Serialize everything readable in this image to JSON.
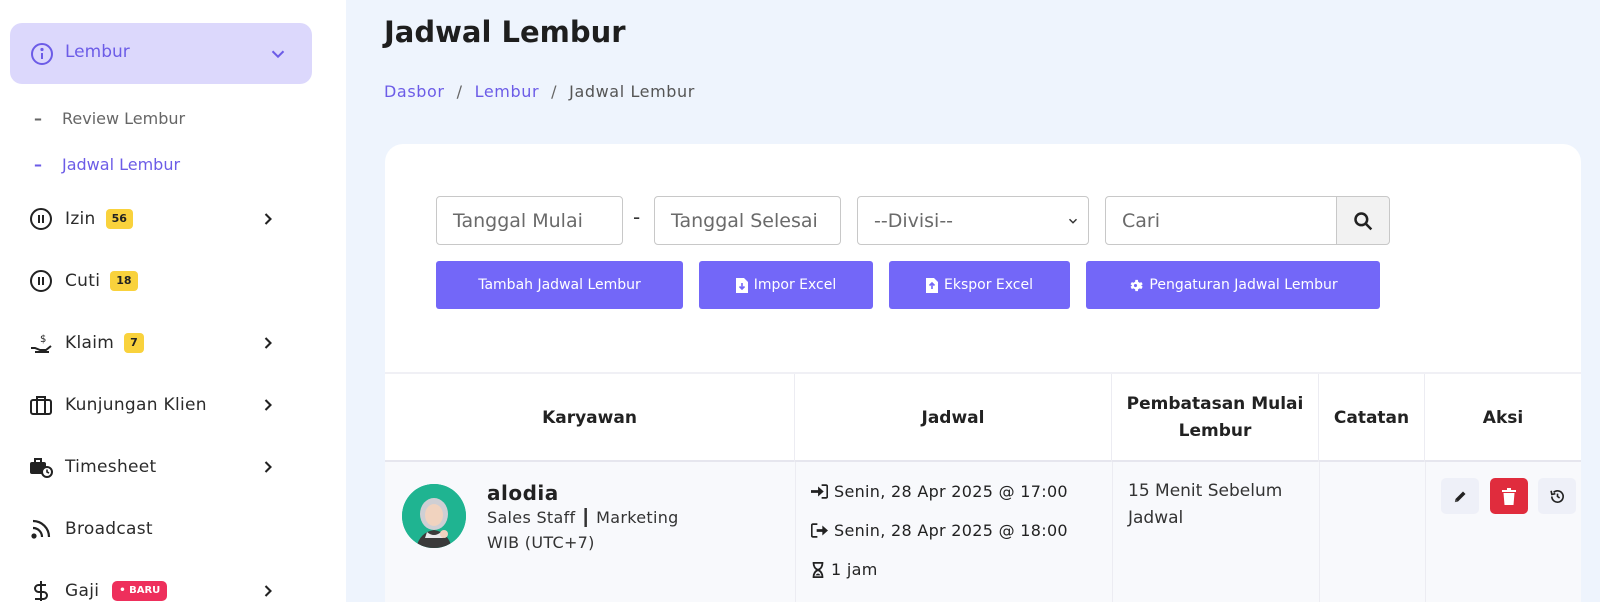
{
  "sidebar": {
    "open_group": {
      "label": "Lembur",
      "icon": "info-circle-icon"
    },
    "sub_items": [
      {
        "label": "Review Lembur",
        "active": false
      },
      {
        "label": "Jadwal Lembur",
        "active": true
      }
    ],
    "items": [
      {
        "label": "Izin",
        "icon": "pause-circle-icon",
        "badge": "56",
        "has_arrow": true
      },
      {
        "label": "Cuti",
        "icon": "pause-circle-icon",
        "badge": "18",
        "has_arrow": false
      },
      {
        "label": "Klaim",
        "icon": "hand-money-icon",
        "badge": "7",
        "has_arrow": true
      },
      {
        "label": "Kunjungan Klien",
        "icon": "briefcase-icon",
        "badge": null,
        "has_arrow": true
      },
      {
        "label": "Timesheet",
        "icon": "briefcase-clock-icon",
        "badge": null,
        "has_arrow": true
      },
      {
        "label": "Broadcast",
        "icon": "rss-icon",
        "badge": null,
        "has_arrow": false
      },
      {
        "label": "Gaji",
        "icon": "dollar-icon",
        "badge_new": "• BARU",
        "has_arrow": true
      }
    ]
  },
  "header": {
    "title": "Jadwal Lembur",
    "breadcrumb": {
      "first": "Dasbor",
      "second": "Lembur",
      "current": "Jadwal Lembur",
      "sep": "/"
    }
  },
  "filters": {
    "start_date_placeholder": "Tanggal Mulai",
    "dash": "-",
    "end_date_placeholder": "Tanggal Selesai",
    "division_selected": "--Divisi--",
    "search_placeholder": "Cari"
  },
  "buttons": {
    "add": "Tambah Jadwal Lembur",
    "import": "Impor Excel",
    "export": "Ekspor Excel",
    "settings": "Pengaturan Jadwal Lembur"
  },
  "table": {
    "headers": {
      "employee": "Karyawan",
      "schedule": "Jadwal",
      "limit_line1": "Pembatasan Mulai",
      "limit_line2": "Lembur",
      "note": "Catatan",
      "action": "Aksi"
    },
    "rows": [
      {
        "name": "alodia",
        "role": "Sales Staff ┃ Marketing",
        "timezone": "WIB (UTC+7)",
        "start": "Senin, 28 Apr 2025 @ 17:00",
        "end": "Senin, 28 Apr 2025 @ 18:00",
        "duration": "1 jam",
        "limit_line1": "15 Menit Sebelum",
        "limit_line2": "Jadwal",
        "note": ""
      }
    ]
  },
  "colors": {
    "accent": "#7367f8",
    "sidebar_active_bg": "#dcd8fc",
    "badge_yellow": "#f9d23c",
    "badge_new": "#ee2f5c",
    "delete": "#e02c3d"
  }
}
